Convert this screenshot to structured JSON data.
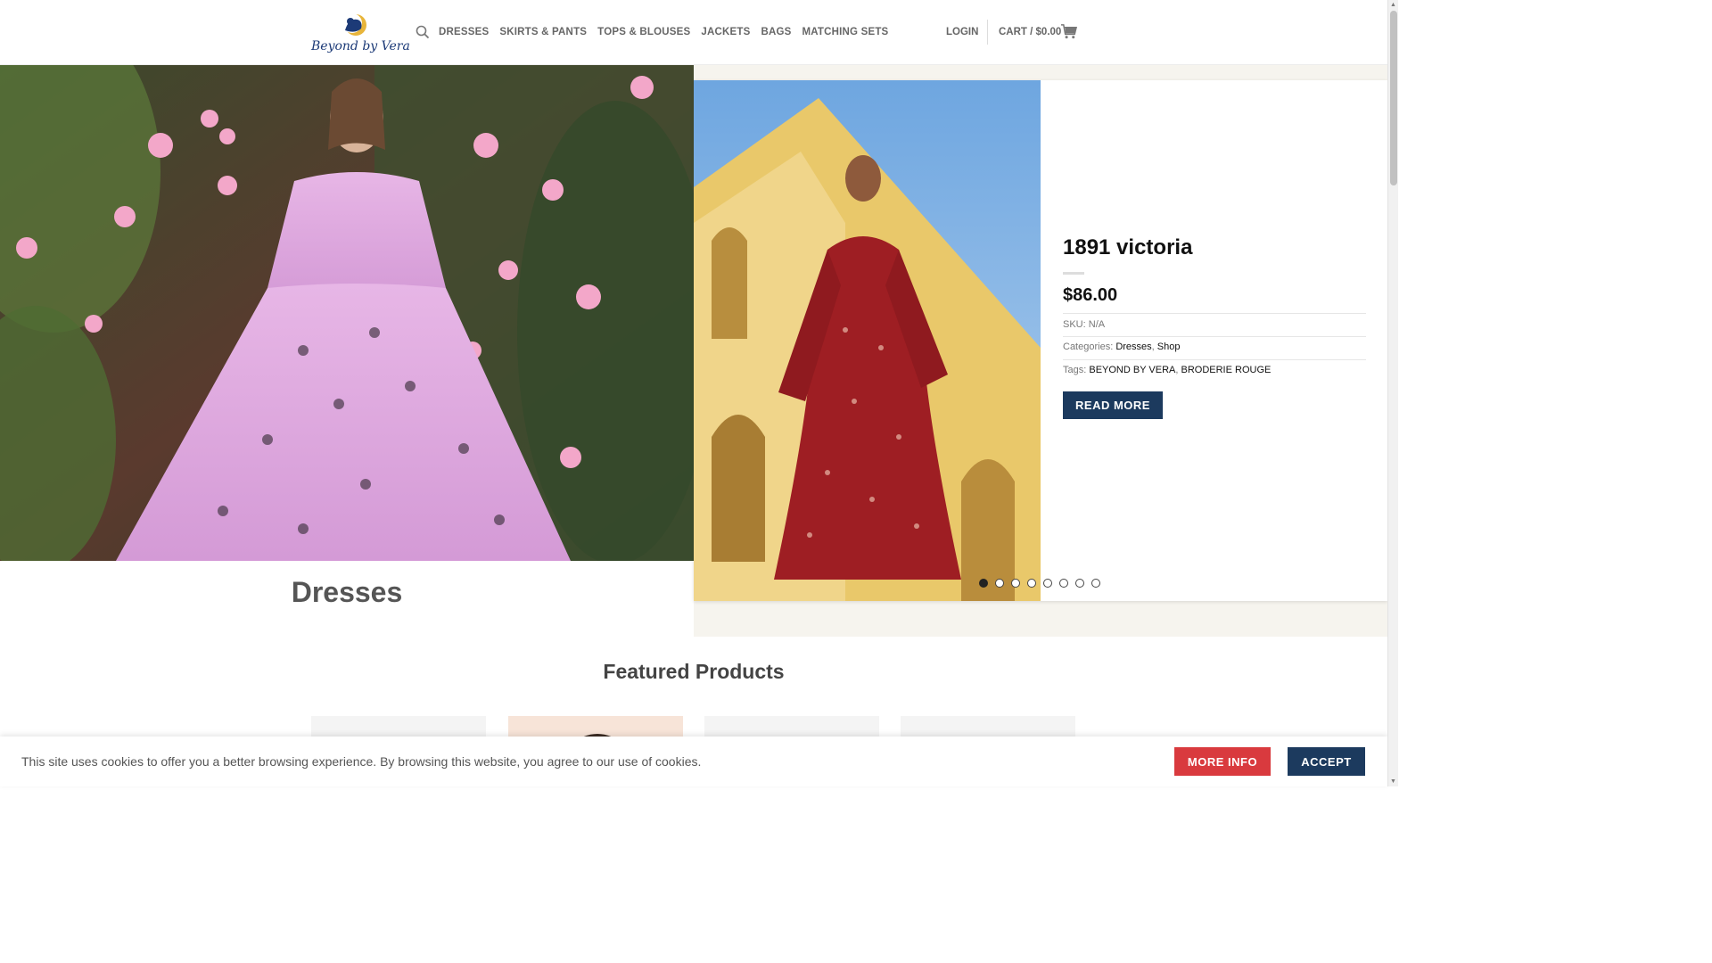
{
  "header": {
    "logo_text": "Beyond by Vera",
    "search_icon": "search-icon",
    "nav": [
      "DRESSES",
      "SKIRTS & PANTS",
      "TOPS & BLOUSES",
      "JACKETS",
      "BAGS",
      "MATCHING SETS"
    ],
    "login": "LOGIN",
    "cart": "CART / $0.00",
    "cart_icon": "cart-icon"
  },
  "hero": {
    "title": "Dresses"
  },
  "product": {
    "title": "1891 victoria",
    "price": "$86.00",
    "sku_label": "SKU:",
    "sku_value": "N/A",
    "categories_label": "Categories:",
    "categories": [
      "Dresses",
      "Shop"
    ],
    "tags_label": "Tags:",
    "tags": [
      "BEYOND BY VERA",
      "BRODERIE ROUGE"
    ],
    "read_more": "READ MORE",
    "slide_count": 8,
    "active_slide": 1
  },
  "featured": {
    "title": "Featured Products"
  },
  "cookie": {
    "text": "This site uses cookies to offer you a better browsing experience. By browsing this website, you agree to our use of cookies.",
    "more_info": "MORE INFO",
    "accept": "ACCEPT"
  },
  "colors": {
    "brand_navy": "#1c3a5e",
    "accent_red": "#d93a3e"
  }
}
